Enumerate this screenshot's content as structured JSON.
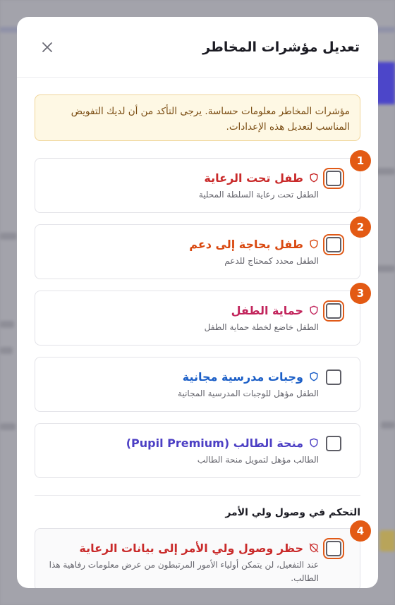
{
  "modal": {
    "title": "تعديل مؤشرات المخاطر",
    "close_icon": "close-icon"
  },
  "warning": {
    "text": "مؤشرات المخاطر معلومات حساسة. يرجى التأكد من أن لديك التفويض المناسب لتعديل هذه الإعدادات."
  },
  "indicators": [
    {
      "title": "طفل تحت الرعاية",
      "desc": "الطفل تحت رعاية السلطة المحلية",
      "color": "#c92a2a",
      "icon": "shield-icon",
      "badge": "1"
    },
    {
      "title": "طفل بحاجة إلى دعم",
      "desc": "الطفل محدد كمحتاج للدعم",
      "color": "#d9480f",
      "icon": "shield-icon",
      "badge": "2"
    },
    {
      "title": "حماية الطفل",
      "desc": "الطفل خاضع لخطة حماية الطفل",
      "color": "#c2255c",
      "icon": "shield-icon",
      "badge": "3"
    },
    {
      "title": "وجبات مدرسية مجانية",
      "desc": "الطفل مؤهل للوجبات المدرسية المجانية",
      "color": "#1c5fc7",
      "icon": "shield-icon",
      "badge": ""
    },
    {
      "title": "منحة الطالب (Pupil Premium)",
      "desc": "الطالب مؤهل لتمويل منحة الطالب",
      "color": "#4c3fc4",
      "icon": "shield-icon",
      "badge": ""
    }
  ],
  "parent_section": {
    "title": "التحكم في وصول ولي الأمر",
    "item": {
      "title": "حظر وصول ولي الأمر إلى بيانات الرعاية",
      "desc": "عند التفعيل، لن يتمكن أولياء الأمور المرتبطون من عرض معلومات رفاهية هذا الطالب.",
      "color": "#c92a2a",
      "icon": "shield-off-icon",
      "badge": "4"
    }
  }
}
